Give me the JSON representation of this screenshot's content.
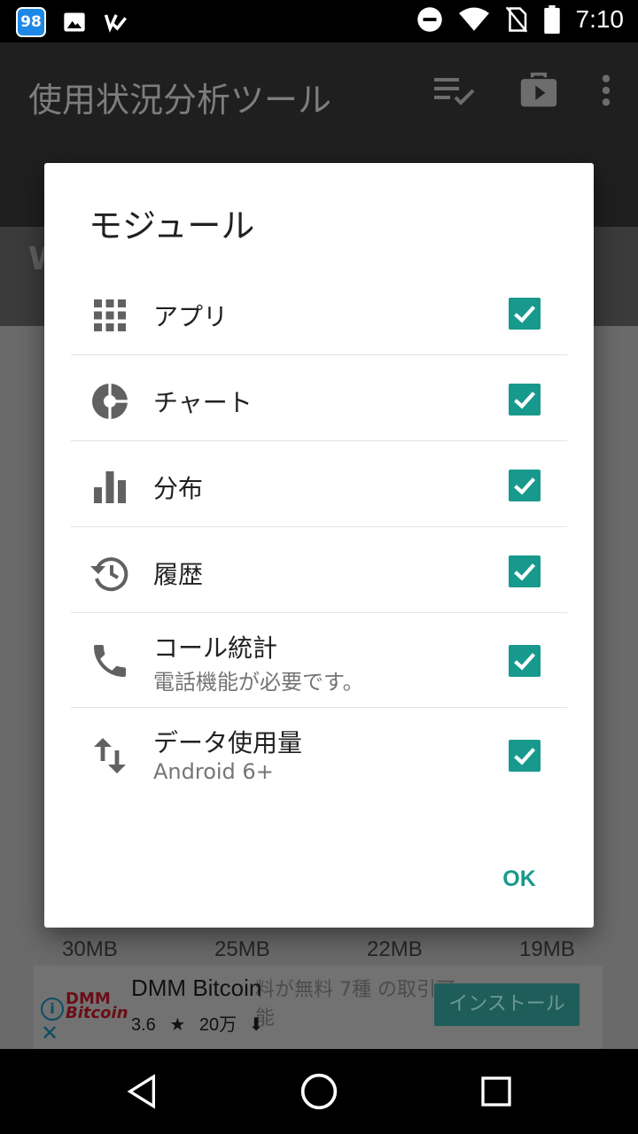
{
  "status_bar": {
    "notification_badge": "98",
    "time": "7:10"
  },
  "app": {
    "title": "使用状況分析ツール"
  },
  "background": {
    "header_initial": "W",
    "sizes": [
      "30MB",
      "25MB",
      "22MB",
      "19MB"
    ],
    "ad": {
      "logo_line1": "DMM",
      "logo_line2": "Bitcoin",
      "title": "DMM Bitcoin",
      "rating": "3.6",
      "downloads": "20万",
      "description": "料が無料 7種 の取引可能",
      "install_label": "インストール"
    }
  },
  "dialog": {
    "title": "モジュール",
    "items": [
      {
        "label": "アプリ",
        "icon": "apps-grid-icon",
        "checked": true
      },
      {
        "label": "チャート",
        "icon": "pie-chart-icon",
        "checked": true
      },
      {
        "label": "分布",
        "icon": "bar-chart-icon",
        "checked": true
      },
      {
        "label": "履歴",
        "icon": "history-icon",
        "checked": true
      },
      {
        "label": "コール統計",
        "sublabel": "電話機能が必要です。",
        "icon": "phone-icon",
        "checked": true
      },
      {
        "label": "データ使用量",
        "sublabel": "Android 6+",
        "icon": "swap-vertical-icon",
        "checked": true
      }
    ],
    "ok_label": "OK"
  },
  "colors": {
    "accent": "#179a8d",
    "icon_gray": "#616161"
  }
}
